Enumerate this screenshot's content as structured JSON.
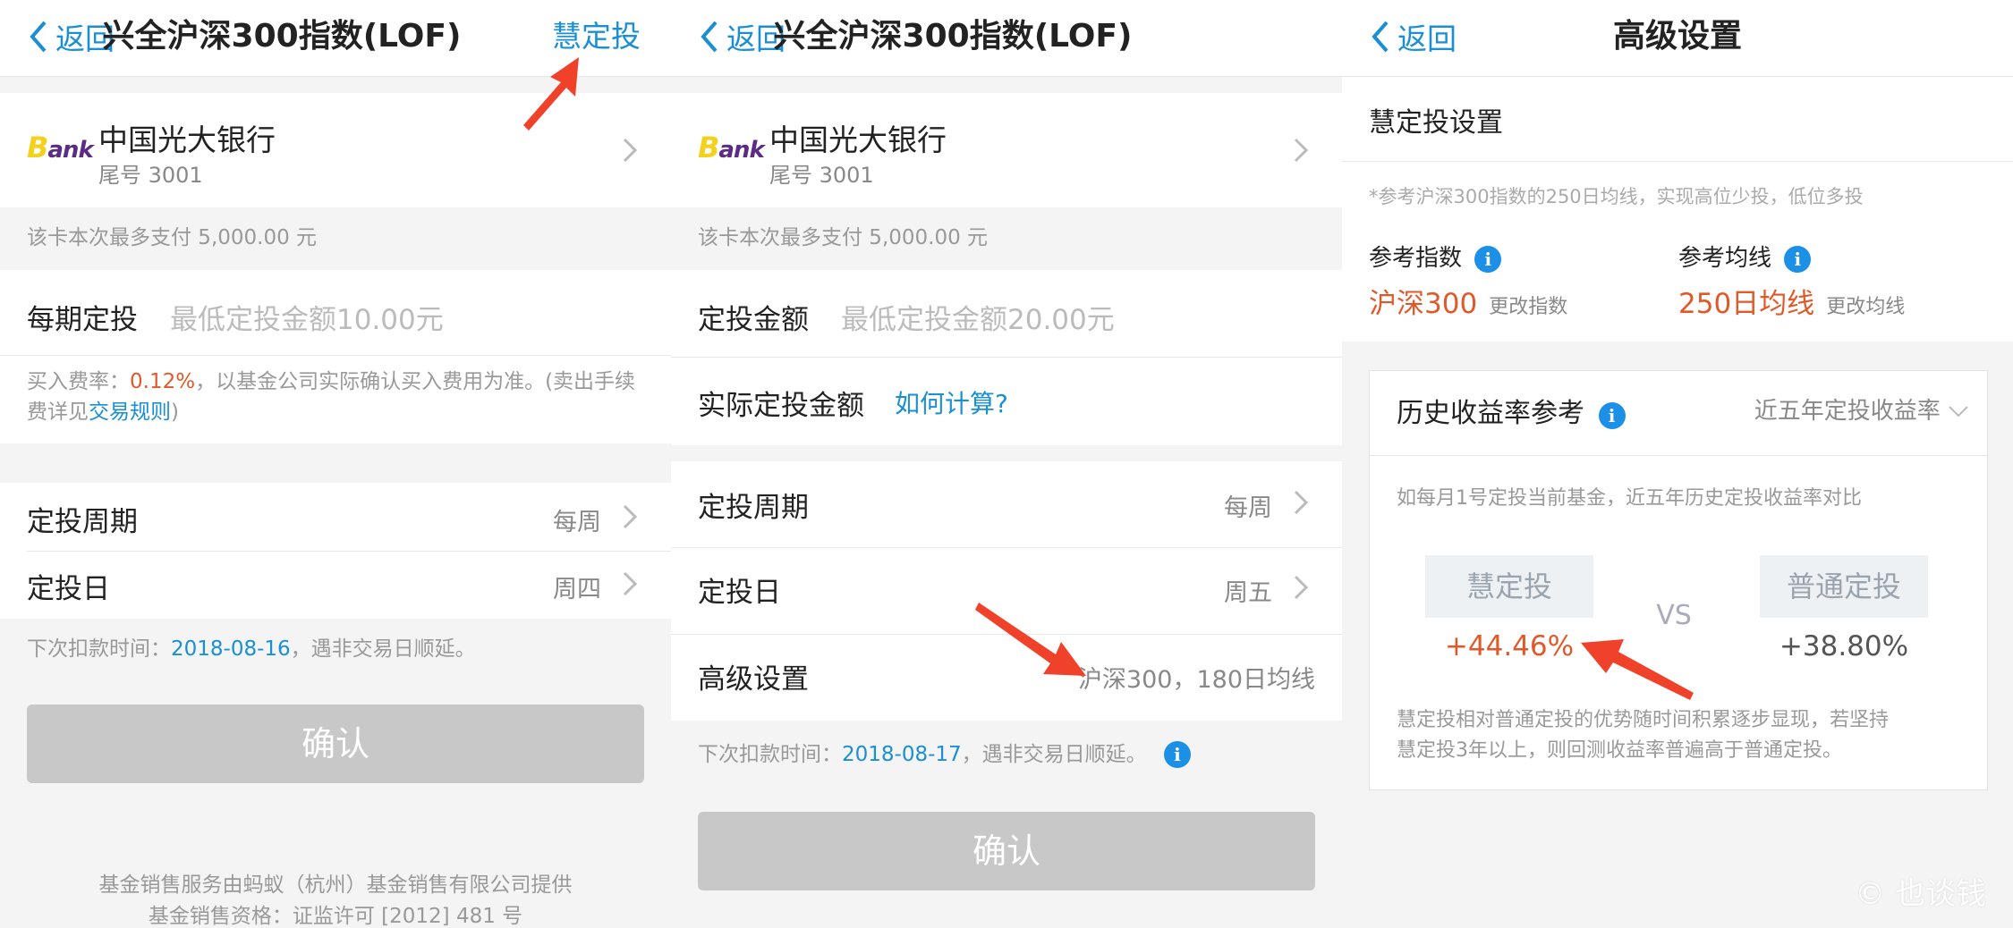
{
  "panel1": {
    "nav": {
      "back": "返回",
      "title": "兴全沪深300指数(LOF)",
      "right": "慧定投"
    },
    "bank": {
      "logo_b": "B",
      "logo_rest": "ank",
      "name": "中国光大银行",
      "tail": "尾号 3001"
    },
    "limit_note": "该卡本次最多支付 5,000.00 元",
    "amount": {
      "label": "每期定投",
      "placeholder": "最低定投金额10.00元"
    },
    "fee": {
      "prefix": "买入费率：",
      "rate": "0.12%",
      "middle": "，以基金公司实际确认买入费用为准。(卖出手续费详见",
      "link": "交易规则",
      "suffix": ")"
    },
    "cycle": {
      "label": "定投周期",
      "value": "每周"
    },
    "day": {
      "label": "定投日",
      "value": "周四"
    },
    "next": {
      "prefix": "下次扣款时间：",
      "date": "2018-08-16",
      "suffix": "，遇非交易日顺延。"
    },
    "confirm": "确认",
    "footer1": "基金销售服务由蚂蚁（杭州）基金销售有限公司提供",
    "footer2": "基金销售资格：证监许可 [2012] 481 号"
  },
  "panel2": {
    "nav": {
      "back": "返回",
      "title": "兴全沪深300指数(LOF)"
    },
    "bank": {
      "logo_b": "B",
      "logo_rest": "ank",
      "name": "中国光大银行",
      "tail": "尾号 3001"
    },
    "limit_note": "该卡本次最多支付 5,000.00 元",
    "amount": {
      "label": "定投金额",
      "placeholder": "最低定投金额20.00元"
    },
    "actual": {
      "label": "实际定投金额",
      "link": "如何计算?"
    },
    "cycle": {
      "label": "定投周期",
      "value": "每周"
    },
    "day": {
      "label": "定投日",
      "value": "周五"
    },
    "advanced": {
      "label": "高级设置",
      "value": "沪深300，180日均线"
    },
    "next": {
      "prefix": "下次扣款时间：",
      "date": "2018-08-17",
      "suffix": "，遇非交易日顺延。"
    },
    "confirm": "确认"
  },
  "panel3": {
    "nav": {
      "back": "返回",
      "title": "高级设置"
    },
    "section_title": "慧定投设置",
    "hint": "*参考沪深300指数的250日均线，实现高位少投，低位多投",
    "ref_index": {
      "label": "参考指数",
      "value": "沪深300",
      "change": "更改指数"
    },
    "ref_ma": {
      "label": "参考均线",
      "value": "250日均线",
      "change": "更改均线"
    },
    "history": {
      "title": "历史收益率参考",
      "dropdown": "近五年定投收益率",
      "desc": "如每月1号定投当前基金，近五年历史定投收益率对比",
      "smart_label": "慧定投",
      "smart_value": "+44.46%",
      "vs": "VS",
      "normal_label": "普通定投",
      "normal_value": "+38.80%",
      "foot1": "慧定投相对普通定投的优势随时间积累逐步显现，若坚持",
      "foot2": "慧定投3年以上，则回测收益率普遍高于普通定投。"
    },
    "watermark": "© 也谈钱"
  },
  "colors": {
    "accent_blue": "#1a8fd3",
    "accent_red": "#e0592a",
    "arrow_red": "#f0412a",
    "button_gray": "#c8c8c8"
  }
}
